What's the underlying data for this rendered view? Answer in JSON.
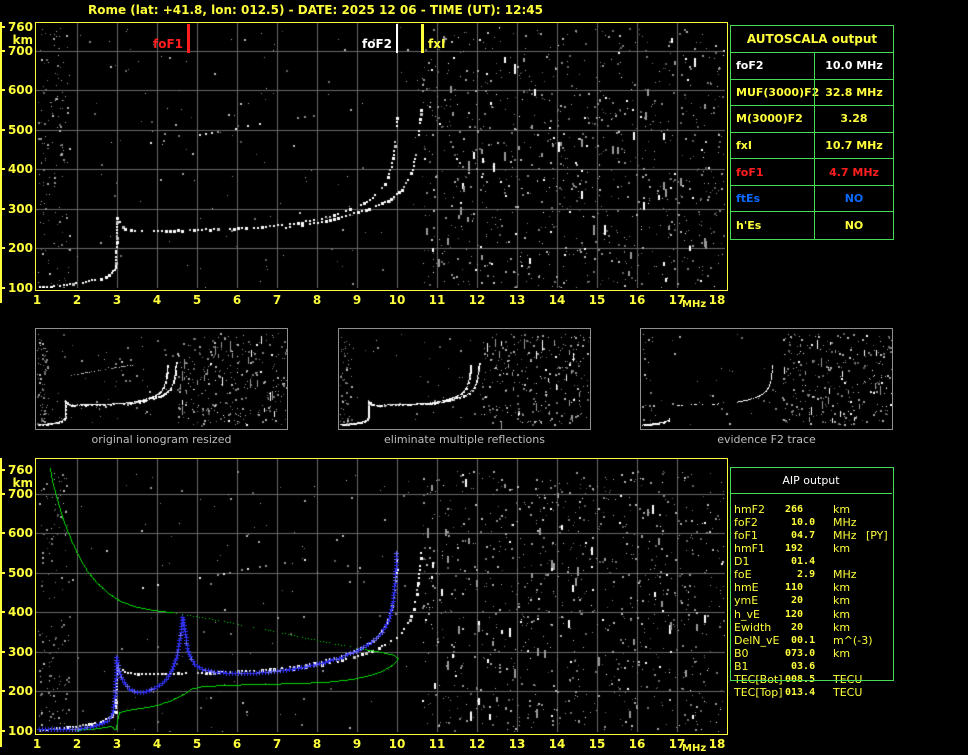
{
  "title": "Rome (lat: +41.8, lon: 012.5) - DATE: 2025 12 06 - TIME (UT): 12:45",
  "colors": {
    "yellow": "#ffff3c",
    "green_border": "#44dd55",
    "red": "#ff1d1d",
    "blue": "#0a6aff",
    "white": "#ffffff",
    "grid": "#686868",
    "trace_green": "#00d800",
    "trace_blue": "#3030f0",
    "caption_gray": "#bdbdbd"
  },
  "top_plot": {
    "y_top": "760",
    "y_unit": "km",
    "y_ticks": [
      "700",
      "600",
      "500",
      "400",
      "300",
      "200",
      "100"
    ],
    "x_ticks": [
      "1",
      "2",
      "3",
      "4",
      "5",
      "6",
      "7",
      "8",
      "9",
      "10",
      "11",
      "12",
      "13",
      "14",
      "15",
      "16",
      "17",
      "18"
    ],
    "x_unit": "MHz",
    "markers": [
      {
        "label": "foF1",
        "freq": 4.78,
        "color": "#ff1d1d",
        "side": "left",
        "width": 3
      },
      {
        "label": "foF2",
        "freq": 10.0,
        "color": "#ffffff",
        "side": "left",
        "width": 2
      },
      {
        "label": "fxI",
        "freq": 10.62,
        "color": "#ffff3c",
        "side": "right",
        "width": 3
      }
    ]
  },
  "bottom_plot": {
    "y_top": "760",
    "y_unit": "km",
    "y_ticks": [
      "700",
      "600",
      "500",
      "400",
      "300",
      "200",
      "100"
    ],
    "x_ticks": [
      "1",
      "2",
      "3",
      "4",
      "5",
      "6",
      "7",
      "8",
      "9",
      "10",
      "11",
      "12",
      "13",
      "14",
      "15",
      "16",
      "17",
      "18"
    ],
    "x_unit": "MHz"
  },
  "autoscala": {
    "title": "AUTOSCALA output",
    "rows": [
      {
        "param": "foF2",
        "value": "10.0 MHz",
        "color": "#ffffff"
      },
      {
        "param": "MUF(3000)F2",
        "value": "32.8 MHz",
        "color": "#ffff3c"
      },
      {
        "param": "M(3000)F2",
        "value": "3.28",
        "color": "#ffff3c"
      },
      {
        "param": "fxI",
        "value": "10.7 MHz",
        "color": "#ffff3c"
      },
      {
        "param": "foF1",
        "value": "4.7 MHz",
        "color": "#ff1d1d"
      },
      {
        "param": "ftEs",
        "value": "NO",
        "color": "#0a6aff"
      },
      {
        "param": "h'Es",
        "value": "NO",
        "color": "#ffff3c"
      }
    ]
  },
  "thumbnails": [
    {
      "caption": "original ionogram resized"
    },
    {
      "caption": "eliminate multiple reflections"
    },
    {
      "caption": "evidence F2 trace"
    }
  ],
  "aip": {
    "title": "AIP output",
    "rows": [
      {
        "param": "hmF2",
        "value": "266",
        "unit": "km",
        "extra": ""
      },
      {
        "param": "foF2",
        "value": " 10.0",
        "unit": "MHz",
        "extra": ""
      },
      {
        "param": "foF1",
        "value": " 04.7",
        "unit": "MHz",
        "extra": "[PY]"
      },
      {
        "param": "hmF1",
        "value": "192",
        "unit": "km",
        "extra": ""
      },
      {
        "param": "D1",
        "value": " 01.4",
        "unit": "",
        "extra": ""
      },
      {
        "param": "foE",
        "value": "  2.9",
        "unit": "MHz",
        "extra": ""
      },
      {
        "param": "hmE",
        "value": "110",
        "unit": "km",
        "extra": ""
      },
      {
        "param": "ymE",
        "value": " 20",
        "unit": "km",
        "extra": ""
      },
      {
        "param": "h_vE",
        "value": "120",
        "unit": "km",
        "extra": ""
      },
      {
        "param": "Ewidth",
        "value": " 20",
        "unit": "km",
        "extra": ""
      },
      {
        "param": "DelN_vE",
        "value": " 00.1",
        "unit": "m^(-3)",
        "extra": ""
      },
      {
        "param": "B0",
        "value": "073.0",
        "unit": "km",
        "extra": ""
      },
      {
        "param": "B1",
        "value": " 03.6",
        "unit": "",
        "extra": ""
      },
      {
        "param": "TEC[Bot]",
        "value": "008.5",
        "unit": "TECU",
        "extra": ""
      },
      {
        "param": "TEC[Top]",
        "value": "013.4",
        "unit": "TECU",
        "extra": ""
      }
    ]
  },
  "traces": {
    "e_trace": [
      [
        1.05,
        104
      ],
      [
        1.4,
        107
      ],
      [
        1.8,
        112
      ],
      [
        2.2,
        118
      ],
      [
        2.5,
        124
      ],
      [
        2.7,
        131
      ],
      [
        2.85,
        140
      ],
      [
        2.92,
        150
      ]
    ],
    "e_cusp": [
      [
        2.95,
        152
      ],
      [
        2.96,
        190
      ],
      [
        2.97,
        235
      ],
      [
        2.98,
        278
      ]
    ],
    "f_o": [
      [
        3.05,
        268
      ],
      [
        3.12,
        256
      ],
      [
        3.25,
        249
      ],
      [
        3.5,
        246
      ],
      [
        4.0,
        247
      ],
      [
        4.5,
        248
      ],
      [
        5.0,
        249
      ],
      [
        5.5,
        251
      ],
      [
        6.0,
        253
      ],
      [
        6.5,
        256
      ],
      [
        7.0,
        260
      ],
      [
        7.4,
        265
      ],
      [
        7.8,
        272
      ],
      [
        8.2,
        281
      ],
      [
        8.6,
        293
      ],
      [
        9.0,
        308
      ],
      [
        9.3,
        325
      ],
      [
        9.55,
        347
      ],
      [
        9.72,
        375
      ],
      [
        9.84,
        410
      ],
      [
        9.91,
        450
      ],
      [
        9.95,
        492
      ],
      [
        9.98,
        532
      ]
    ],
    "f_x": [
      [
        7.2,
        256
      ],
      [
        7.6,
        261
      ],
      [
        8.0,
        268
      ],
      [
        8.4,
        276
      ],
      [
        8.8,
        287
      ],
      [
        9.2,
        300
      ],
      [
        9.6,
        316
      ],
      [
        9.9,
        333
      ],
      [
        10.1,
        352
      ],
      [
        10.25,
        375
      ],
      [
        10.37,
        403
      ],
      [
        10.45,
        438
      ],
      [
        10.51,
        478
      ],
      [
        10.55,
        520
      ],
      [
        10.57,
        552
      ]
    ],
    "second_hop": [
      [
        3.45,
        462
      ],
      [
        4.0,
        472
      ],
      [
        4.6,
        482
      ],
      [
        5.2,
        492
      ],
      [
        5.8,
        503
      ],
      [
        6.4,
        514
      ],
      [
        7.0,
        524
      ],
      [
        7.5,
        532
      ],
      [
        7.85,
        538
      ]
    ],
    "green_bottom": [
      [
        2.0,
        103
      ],
      [
        2.4,
        106
      ],
      [
        2.7,
        110
      ],
      [
        2.85,
        113
      ],
      [
        2.93,
        106
      ],
      [
        2.97,
        104
      ],
      [
        3.0,
        125
      ],
      [
        3.05,
        148
      ],
      [
        3.3,
        154
      ],
      [
        3.7,
        160
      ],
      [
        4.0,
        166
      ],
      [
        4.3,
        176
      ],
      [
        4.55,
        188
      ],
      [
        4.7,
        196
      ],
      [
        4.85,
        207
      ],
      [
        5.1,
        213
      ],
      [
        5.6,
        216
      ],
      [
        6.5,
        219
      ],
      [
        7.5,
        221
      ],
      [
        8.3,
        225
      ],
      [
        8.9,
        232
      ],
      [
        9.3,
        241
      ],
      [
        9.6,
        251
      ],
      [
        9.8,
        262
      ],
      [
        9.95,
        274
      ],
      [
        10.02,
        284
      ],
      [
        9.9,
        293
      ],
      [
        9.6,
        300
      ],
      [
        9.2,
        307
      ]
    ],
    "green_dotted": [
      [
        9.2,
        307
      ],
      [
        8.6,
        318
      ],
      [
        8.0,
        330
      ],
      [
        7.2,
        347
      ],
      [
        6.4,
        363
      ],
      [
        5.6,
        379
      ],
      [
        4.9,
        392
      ],
      [
        4.4,
        400
      ]
    ],
    "green_topside": [
      [
        4.4,
        400
      ],
      [
        3.9,
        406
      ],
      [
        3.5,
        414
      ],
      [
        3.1,
        428
      ],
      [
        2.8,
        447
      ],
      [
        2.5,
        474
      ],
      [
        2.25,
        505
      ],
      [
        2.05,
        540
      ],
      [
        1.85,
        583
      ],
      [
        1.65,
        635
      ],
      [
        1.5,
        686
      ],
      [
        1.38,
        733
      ],
      [
        1.32,
        765
      ]
    ],
    "blue_trace": [
      [
        1.0,
        104
      ],
      [
        1.5,
        104
      ],
      [
        2.0,
        106
      ],
      [
        2.3,
        110
      ],
      [
        2.55,
        117
      ],
      [
        2.75,
        126
      ],
      [
        2.87,
        140
      ],
      [
        2.92,
        165
      ],
      [
        2.95,
        200
      ],
      [
        2.97,
        250
      ],
      [
        2.98,
        288
      ],
      [
        3.05,
        252
      ],
      [
        3.15,
        226
      ],
      [
        3.3,
        207
      ],
      [
        3.5,
        199
      ],
      [
        3.7,
        200
      ],
      [
        3.9,
        208
      ],
      [
        4.1,
        220
      ],
      [
        4.25,
        236
      ],
      [
        4.38,
        258
      ],
      [
        4.48,
        288
      ],
      [
        4.55,
        322
      ],
      [
        4.6,
        358
      ],
      [
        4.63,
        392
      ],
      [
        4.68,
        362
      ],
      [
        4.73,
        326
      ],
      [
        4.78,
        300
      ],
      [
        4.85,
        282
      ],
      [
        4.95,
        268
      ],
      [
        5.1,
        258
      ],
      [
        5.35,
        251
      ],
      [
        5.7,
        248
      ],
      [
        6.1,
        247
      ],
      [
        6.5,
        248
      ],
      [
        6.9,
        251
      ],
      [
        7.3,
        256
      ],
      [
        7.7,
        263
      ],
      [
        8.1,
        272
      ],
      [
        8.5,
        284
      ],
      [
        8.9,
        299
      ],
      [
        9.2,
        315
      ],
      [
        9.45,
        333
      ],
      [
        9.65,
        355
      ],
      [
        9.8,
        385
      ],
      [
        9.88,
        420
      ],
      [
        9.93,
        460
      ],
      [
        9.96,
        505
      ],
      [
        9.98,
        555
      ]
    ]
  },
  "chart_data": {
    "type": "ionogram",
    "title": "Rome ionogram autoscaled by AUTOSCALA",
    "x_axis": {
      "label": "MHz",
      "range": [
        1,
        18
      ],
      "grid": true
    },
    "y_axis": {
      "label": "km",
      "range": [
        100,
        760
      ],
      "grid": true
    },
    "scaled_values": {
      "foF2_MHz": 10.0,
      "MUF3000F2_MHz": 32.8,
      "M3000F2": 3.28,
      "fxI_MHz": 10.7,
      "foF1_MHz": 4.7,
      "ftEs": "NO",
      "hEs": "NO",
      "hmF2_km": 266,
      "hmF1_km": 192,
      "D1": 1.4,
      "foE_MHz": 2.9,
      "hmE_km": 110,
      "ymE_km": 20,
      "h_vE_km": 120,
      "Ewidth_km": 20,
      "DelN_vE_m3": 0.1,
      "B0_km": 73.0,
      "B1": 3.6,
      "TEC_Bot_TECU": 8.5,
      "TEC_Top_TECU": 13.4
    }
  }
}
